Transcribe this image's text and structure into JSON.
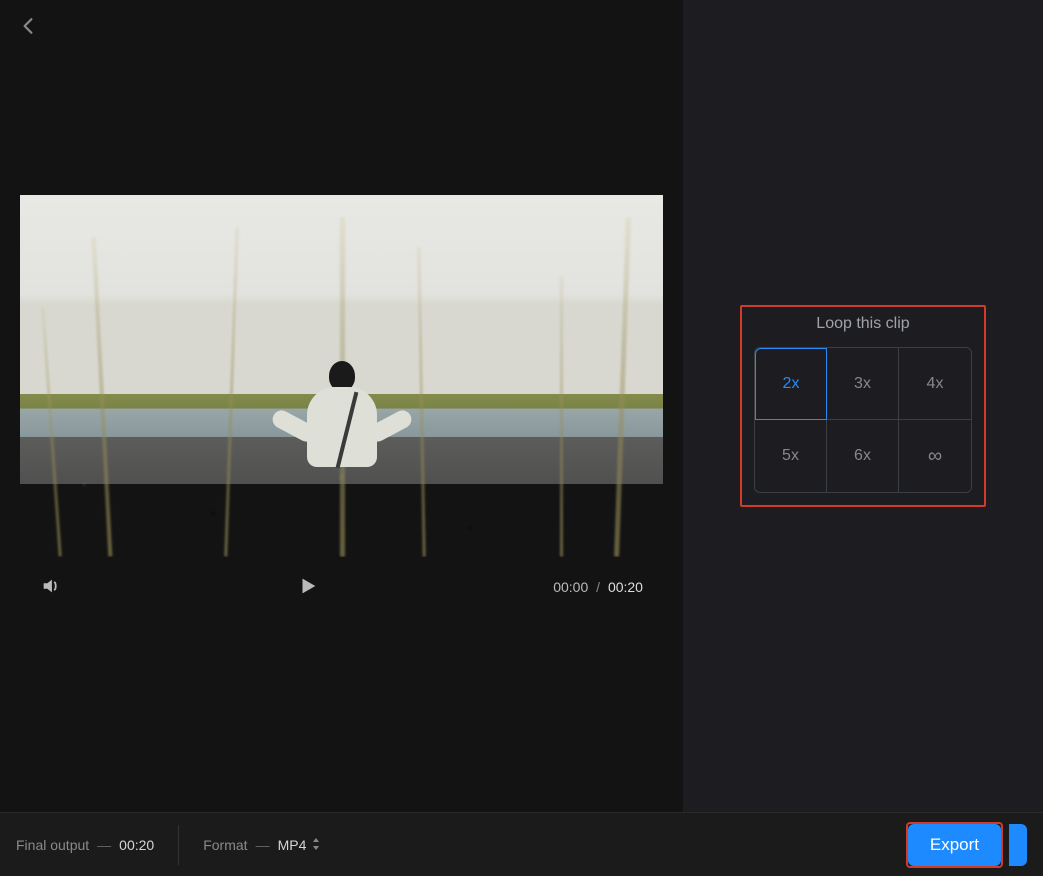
{
  "player": {
    "current_time": "00:00",
    "separator": "/",
    "duration": "00:20"
  },
  "loop": {
    "title": "Loop this clip",
    "options": [
      "2x",
      "3x",
      "4x",
      "5x",
      "6x",
      "∞"
    ],
    "selected_index": 0
  },
  "footer": {
    "final_output_label": "Final output",
    "dash": "—",
    "final_output_value": "00:20",
    "format_label": "Format",
    "format_value": "MP4",
    "export_label": "Export"
  },
  "icons": {
    "back": "chevron-left",
    "volume": "volume",
    "play": "play",
    "infinity": "infinity",
    "select-stepper": "stepper"
  },
  "annotations": {
    "highlight_loop_panel": true,
    "highlight_export_button": true
  }
}
